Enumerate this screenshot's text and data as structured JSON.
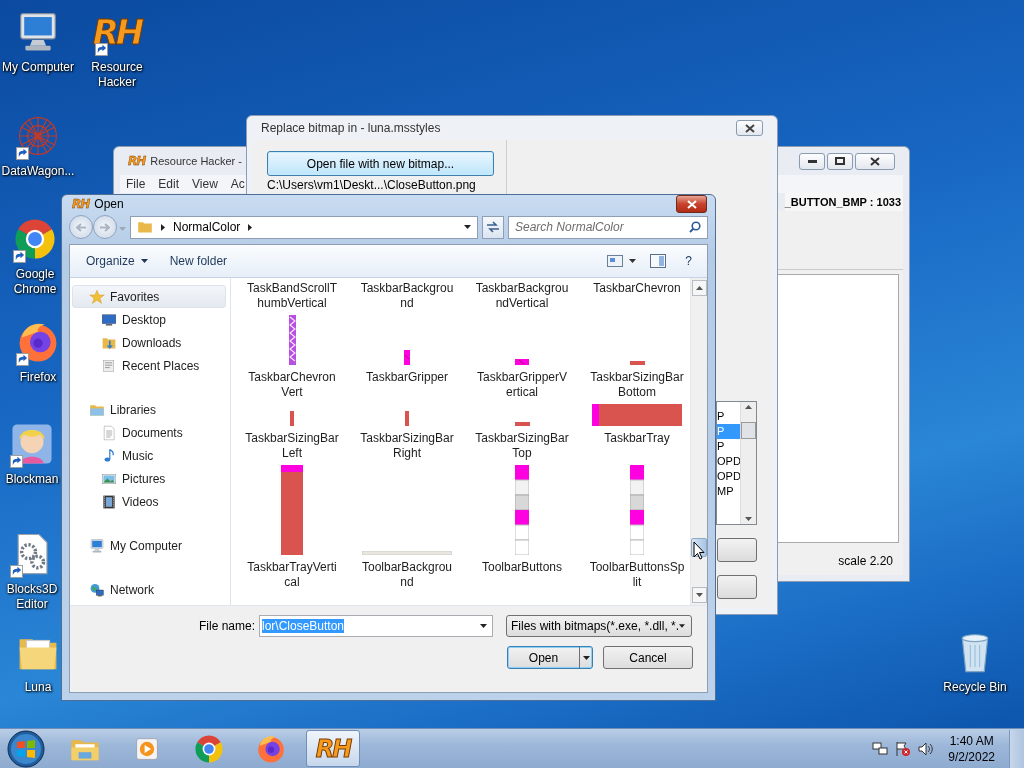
{
  "desktop_icons": [
    {
      "label": "My Computer",
      "kind": "computer",
      "shortcut": false
    },
    {
      "label": "Resource Hacker",
      "kind": "rh",
      "logo": "RH",
      "shortcut": true
    },
    {
      "label": "DataWagon...",
      "kind": "web",
      "shortcut": true
    },
    {
      "label": "Google Chrome",
      "kind": "chrome",
      "shortcut": true
    },
    {
      "label": "Firefox",
      "kind": "firefox",
      "shortcut": true
    },
    {
      "label": "Blockman",
      "kind": "game",
      "shortcut": true
    },
    {
      "label": "Blocks3D Editor",
      "kind": "gears",
      "shortcut": true
    },
    {
      "label": "Luna",
      "kind": "folder",
      "shortcut": false
    },
    {
      "label": "Recycle Bin",
      "kind": "bin",
      "shortcut": false
    }
  ],
  "resource_hacker_window": {
    "icon": "RH",
    "title": "Resource Hacker -",
    "menu": [
      "File",
      "Edit",
      "View",
      "Ac"
    ],
    "resource_name": "_BUTTON_BMP : 1033",
    "status": "scale 2.20"
  },
  "replace_window": {
    "title": "Replace bitmap in - luna.msstyles",
    "open_button": "Open file with new bitmap...",
    "file_path": "C:\\Users\\vm1\\Deskt...\\CloseButton.png",
    "list_items": [
      {
        "text": "P",
        "selected": false
      },
      {
        "text": "P",
        "selected": true
      },
      {
        "text": "P",
        "selected": false
      },
      {
        "text": "OPD",
        "selected": false
      },
      {
        "text": "OPD",
        "selected": false
      },
      {
        "text": "MP",
        "selected": false
      }
    ]
  },
  "open_dialog": {
    "icon": "RH",
    "title": "Open",
    "breadcrumb": "NormalColor",
    "search_placeholder": "Search NormalColor",
    "toolbar": [
      {
        "label": "Organize",
        "menu": true
      },
      {
        "label": "New folder",
        "menu": false
      }
    ],
    "help": "?",
    "nav": [
      {
        "label": "Favorites",
        "kind": "favorites",
        "selected": true,
        "children": [
          {
            "label": "Desktop",
            "kind": "desktop",
            "selected": false
          },
          {
            "label": "Downloads",
            "kind": "downloads",
            "selected": false
          },
          {
            "label": "Recent Places",
            "kind": "recent",
            "selected": false
          }
        ]
      },
      {
        "label": "Libraries",
        "kind": "libraries",
        "selected": false,
        "children": [
          {
            "label": "Documents",
            "kind": "documents",
            "selected": false
          },
          {
            "label": "Music",
            "kind": "music",
            "selected": false
          },
          {
            "label": "Pictures",
            "kind": "pictures",
            "selected": false
          },
          {
            "label": "Videos",
            "kind": "videos",
            "selected": false
          }
        ]
      },
      {
        "label": "My Computer",
        "kind": "computer",
        "selected": false
      },
      {
        "label": "Network",
        "kind": "network",
        "selected": false
      }
    ],
    "files": [
      {
        "label": "TaskBandScrollThumbVertical"
      },
      {
        "label": "TaskbarBackground"
      },
      {
        "label": "TaskbarBackgroundVertical"
      },
      {
        "label": "TaskbarChevron"
      },
      {
        "label": "TaskbarChevronVert",
        "kind": "chevron-vertical"
      },
      {
        "label": "TaskbarGripper",
        "kind": "gripper"
      },
      {
        "label": "TaskbarGripperVertical",
        "kind": "gripper-vertical"
      },
      {
        "label": "TaskbarSizingBarBottom",
        "kind": "bar-horizontal"
      },
      {
        "label": "TaskbarSizingBarLeft",
        "kind": "bar-vertical"
      },
      {
        "label": "TaskbarSizingBarRight",
        "kind": "bar-vertical"
      },
      {
        "label": "TaskbarSizingBarTop",
        "kind": "bar-horizontal"
      },
      {
        "label": "TaskbarTray",
        "kind": "tray"
      },
      {
        "label": "TaskbarTrayVertical",
        "kind": "tray-vertical"
      },
      {
        "label": "ToolbarBackground",
        "kind": "toolbar-background"
      },
      {
        "label": "ToolbarButtons",
        "kind": "toolbar-buttons"
      },
      {
        "label": "ToolbarButtonsSplit",
        "kind": "toolbar-buttons"
      }
    ],
    "file_name_label": "File name:",
    "file_name": "lor\\CloseButton",
    "file_type": "Files with bitmaps(*.exe, *.dll, *.",
    "buttons": [
      {
        "label": "Open",
        "split": true
      },
      {
        "label": "Cancel",
        "split": false
      }
    ]
  },
  "taskbar": {
    "pinned": [
      {
        "kind": "explorer",
        "active": false
      },
      {
        "kind": "media",
        "active": false
      },
      {
        "kind": "chrome",
        "active": false
      },
      {
        "kind": "firefox",
        "active": false
      },
      {
        "kind": "rh",
        "logo": "RH",
        "active": true
      }
    ],
    "time": "1:40 AM",
    "date": "9/2/2022"
  }
}
